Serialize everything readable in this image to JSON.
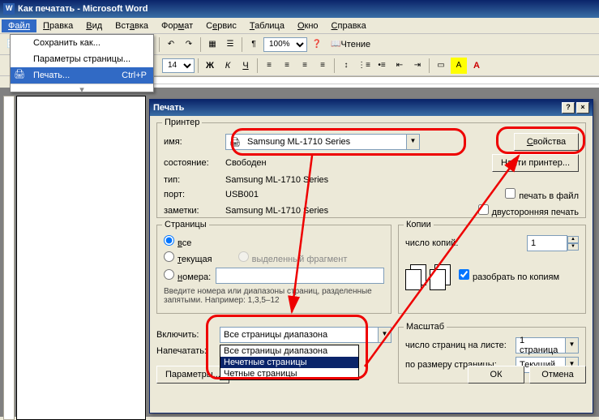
{
  "window": {
    "title": "Как печатать - Microsoft Word"
  },
  "menubar": [
    "Файл",
    "Правка",
    "Вид",
    "Вставка",
    "Формат",
    "Сервис",
    "Таблица",
    "Окно",
    "Справка"
  ],
  "file_menu": {
    "save_as": "Сохранить как...",
    "page_setup": "Параметры страницы...",
    "print": "Печать...",
    "print_shortcut": "Ctrl+P"
  },
  "toolbar": {
    "font_size": "14",
    "zoom": "100%",
    "read": "Чтение"
  },
  "dialog": {
    "title": "Печать",
    "printer": {
      "legend": "Принтер",
      "name_lbl": "имя:",
      "name_val": "Samsung ML-1710 Series",
      "status_lbl": "состояние:",
      "status_val": "Свободен",
      "type_lbl": "тип:",
      "type_val": "Samsung ML-1710 Series",
      "port_lbl": "порт:",
      "port_val": "USB001",
      "notes_lbl": "заметки:",
      "notes_val": "Samsung ML-1710 Series",
      "properties_btn": "Свойства",
      "find_btn": "Найти принтер...",
      "to_file": "печать в файл",
      "duplex": "двусторонняя печать"
    },
    "pages": {
      "legend": "Страницы",
      "all": "все",
      "current": "текущая",
      "selection": "выделенный фрагмент",
      "numbers": "номера:",
      "hint": "Введите номера или диапазоны страниц, разделенные запятыми. Например: 1,3,5–12"
    },
    "copies": {
      "legend": "Копии",
      "count_lbl": "число копий:",
      "count_val": "1",
      "collate": "разобрать по копиям"
    },
    "include": {
      "label": "Включить:",
      "selected": "Все страницы диапазона",
      "options": [
        "Все страницы диапазона",
        "Нечетные страницы",
        "Четные страницы"
      ]
    },
    "print_what": {
      "label": "Напечатать:"
    },
    "scale": {
      "legend": "Масштаб",
      "per_sheet_lbl": "число страниц на листе:",
      "per_sheet_val": "1 страница",
      "fit_lbl": "по размеру страницы:",
      "fit_val": "Текущий"
    },
    "params_btn": "Параметры...",
    "ok": "ОК",
    "cancel": "Отмена"
  }
}
